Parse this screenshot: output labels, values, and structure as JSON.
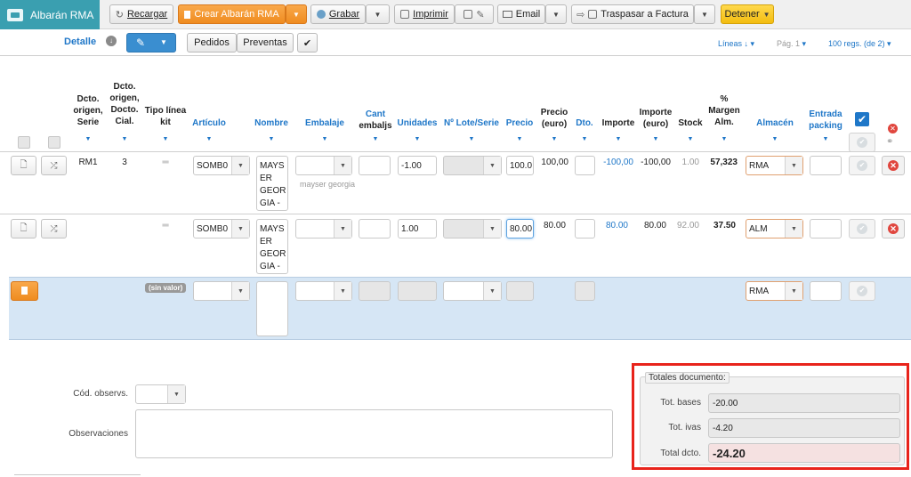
{
  "app": {
    "title": "Albarán RMA"
  },
  "toolbar": {
    "recargar": "Recargar",
    "crear": "Crear Albarán RMA",
    "grabar": "Grabar",
    "imprimir": "Imprimir",
    "email": "Email",
    "traspasar": "Traspasar a Factura",
    "detener": "Detener"
  },
  "subbar": {
    "detalle": "Detalle",
    "pedidos": "Pedidos",
    "preventas": "Preventas",
    "lineas": "Líneas",
    "pagina": "Pág. 1",
    "regs": "100 regs. (de 2)"
  },
  "columns": {
    "dcto_origen_serie": [
      "Dcto.",
      "origen,",
      "Serie"
    ],
    "dcto_origen_cial": [
      "Dcto.",
      "origen,",
      "Docto.",
      "Cial."
    ],
    "tipo_linea": [
      "Tipo línea",
      "kit"
    ],
    "articulo": "Artículo",
    "nombre": "Nombre",
    "embalaje": "Embalaje",
    "cant_embaljs": [
      "Cant",
      "embaljs"
    ],
    "unidades": "Unidades",
    "lote": "Nº Lote/Serie",
    "precio": "Precio",
    "precio_euro": [
      "Precio",
      "(euro)"
    ],
    "dto": "Dto.",
    "importe": "Importe",
    "importe_euro": [
      "Importe",
      "(euro)"
    ],
    "stock": "Stock",
    "margen": [
      "%",
      "Margen",
      "Alm."
    ],
    "almacen": "Almacén",
    "entrada_packing": [
      "Entrada",
      "packing"
    ]
  },
  "rows": [
    {
      "serie": "RM1",
      "cial": "3",
      "tipo": "═",
      "articulo": "SOMB0",
      "nombre": "MAYS\nER\nGEOR\nGIA -",
      "nombre_sub": "mayser georgia",
      "unidades": "-1.00",
      "precio": "100.0",
      "precio_euro": "100,00",
      "importe": "-100,00",
      "importe_euro": "-100,00",
      "stock": "1.00",
      "margen": "57,323",
      "almacen": "RMA"
    },
    {
      "serie": "",
      "cial": "",
      "tipo": "═",
      "articulo": "SOMB0",
      "nombre": "MAYS\nER\nGEOR\nGIA -",
      "nombre_sub": "",
      "unidades": "1.00",
      "precio": "80.00",
      "precio_euro": "80.00",
      "importe": "80.00",
      "importe_euro": "80.00",
      "stock": "92.00",
      "margen": "37.50",
      "almacen": "ALM"
    }
  ],
  "new_row": {
    "tipo_badge": "(sin valor)",
    "almacen": "RMA"
  },
  "footer": {
    "cod_observs": "Cód. observs.",
    "observaciones": "Observaciones"
  },
  "totals": {
    "legend": "Totales documento:",
    "bases_label": "Tot. bases",
    "bases": "-20.00",
    "ivas_label": "Tot. ivas",
    "ivas": "-4.20",
    "total_label": "Total dcto.",
    "total": "-24.20"
  },
  "colors": {
    "accent": "#3a9fb0",
    "link": "#1f77c8",
    "orange": "#f39a2e",
    "highlight": "#e8231b"
  }
}
